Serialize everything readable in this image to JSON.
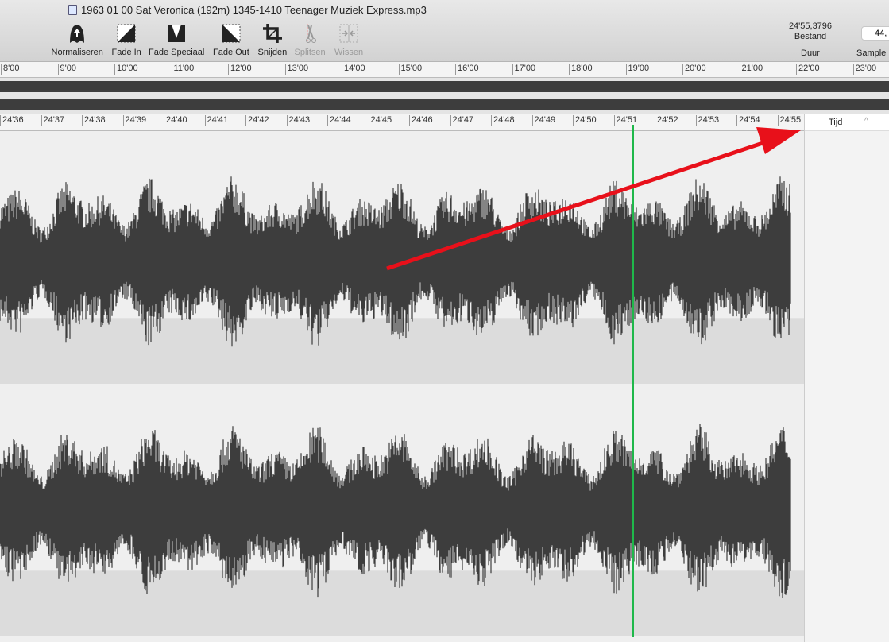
{
  "window": {
    "title": "1963 01 00 Sat Veronica (192m) 1345-1410 Teenager Muziek Express.mp3"
  },
  "toolbar": {
    "tools": [
      {
        "label": "Normaliseren",
        "icon": "normalize-icon",
        "enabled": true
      },
      {
        "label": "Fade In",
        "icon": "fade-in-icon",
        "enabled": true
      },
      {
        "label": "Fade Speciaal",
        "icon": "fade-special-icon",
        "enabled": true
      },
      {
        "label": "Fade Out",
        "icon": "fade-out-icon",
        "enabled": true
      },
      {
        "label": "Snijden",
        "icon": "crop-icon",
        "enabled": true
      },
      {
        "label": "Splitsen",
        "icon": "scissors-icon",
        "enabled": false
      },
      {
        "label": "Wissen",
        "icon": "delete-icon",
        "enabled": false
      }
    ]
  },
  "info": {
    "duration_value": "24'55,3796",
    "duration_source": "Bestand",
    "duration_label": "Duur",
    "sample_value": "44,",
    "sample_label": "Sample"
  },
  "overview_ruler": [
    "8'00",
    "9'00",
    "10'00",
    "11'00",
    "12'00",
    "13'00",
    "14'00",
    "15'00",
    "16'00",
    "17'00",
    "18'00",
    "19'00",
    "20'00",
    "21'00",
    "22'00",
    "23'00"
  ],
  "detail_ruler": [
    "24'36",
    "24'37",
    "24'38",
    "24'39",
    "24'40",
    "24'41",
    "24'42",
    "24'43",
    "24'44",
    "24'45",
    "24'46",
    "24'47",
    "24'48",
    "24'49",
    "24'50",
    "24'51",
    "24'52",
    "24'53",
    "24'54",
    "24'55"
  ],
  "playhead_time": "24'51",
  "side_panel": {
    "column": "Tijd",
    "sort": "ascending"
  },
  "colors": {
    "waveform": "#3d3d3d",
    "playhead": "#1fb84a",
    "annotation_arrow": "#e8101a"
  }
}
